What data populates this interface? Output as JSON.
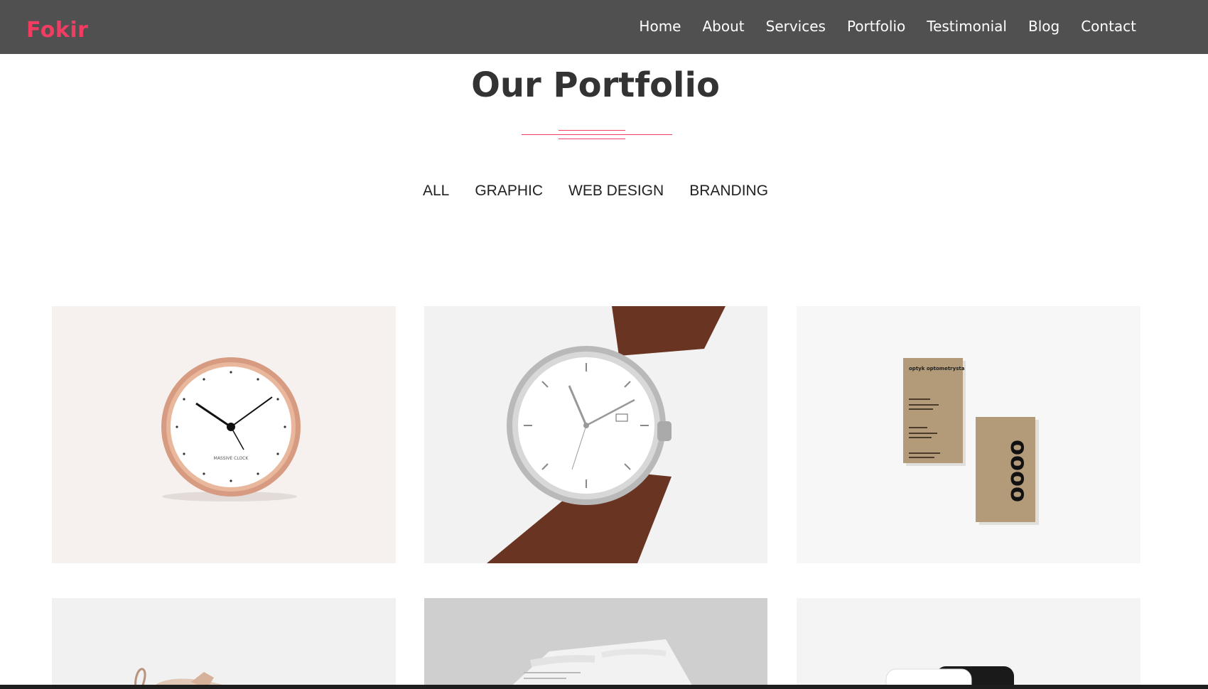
{
  "brand": {
    "logo": "Fokir",
    "accent": "#f23d63"
  },
  "nav": {
    "items": [
      "Home",
      "About",
      "Services",
      "Portfolio",
      "Testimonial",
      "Blog",
      "Contact"
    ]
  },
  "section": {
    "title": "Our Portfolio"
  },
  "filters": [
    "ALL",
    "GRAPHIC",
    "WEB DESIGN",
    "BRANDING"
  ],
  "portfolio": {
    "items": [
      {
        "image": "copper-wall-clock",
        "clock_brand": "MASSIVE CLOCK"
      },
      {
        "image": "silver-watch-brown-strap"
      },
      {
        "image": "kraft-business-cards",
        "card_heading": "optyk optometrysta",
        "card_logo": "oooo"
      },
      {
        "image": "shoe"
      },
      {
        "image": "business-card-arabic"
      },
      {
        "image": "black-white-device"
      }
    ]
  }
}
